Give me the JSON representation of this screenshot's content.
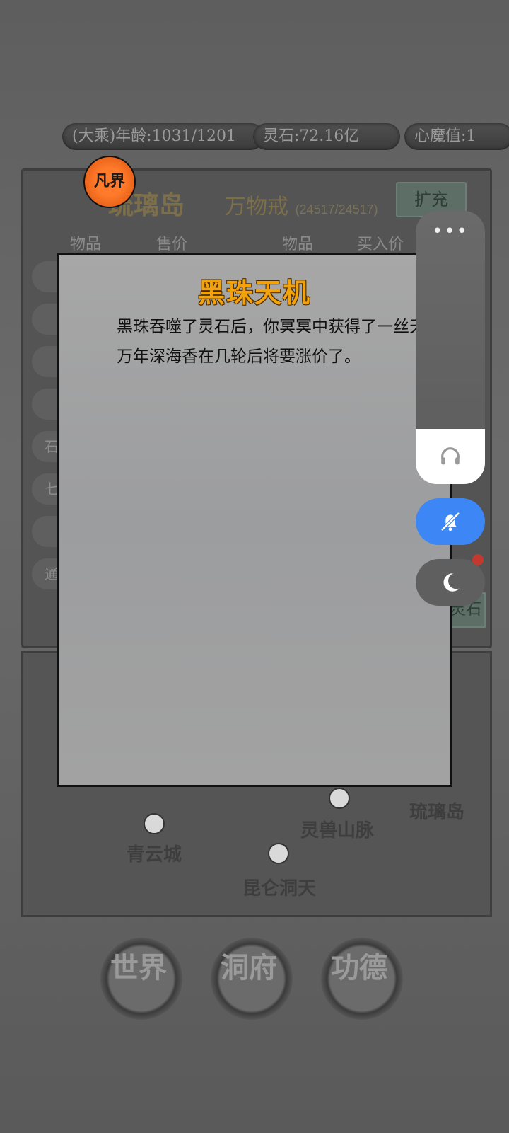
{
  "stats": {
    "realm_age": "(大乘)年龄:1031/1201",
    "spirit_stone": "灵石:72.16亿",
    "demon_value": "心魔值:1"
  },
  "badge": {
    "text": "凡界"
  },
  "shop": {
    "island_name": "琉璃岛",
    "ring_name": "万物戒",
    "ring_count": "(24517/24517)",
    "expand_label": "扩充",
    "col_item_left": "物品",
    "col_sell_price": "售价",
    "col_item_right": "物品",
    "col_buy_price": "买入价",
    "row_stubs": [
      "",
      "",
      "",
      "",
      "石",
      "七",
      "",
      "通"
    ],
    "trade_label": "灵石"
  },
  "map": {
    "locations": [
      "青云城",
      "灵兽山脉",
      "琉璃岛",
      "昆仑洞天"
    ]
  },
  "nav": {
    "world": "世界",
    "cave": "洞府",
    "merit": "功德"
  },
  "dialog": {
    "title": "黑珠天机",
    "paragraph1": "黑珠吞噬了灵石后，你冥冥中获得了一丝天机。",
    "paragraph2": "万年深海香在几轮后将要涨价了。"
  },
  "floating": {
    "more_label": "•••",
    "icons": [
      "headphones-icon",
      "bell-off-icon",
      "moon-icon"
    ],
    "accent": "#3d86f5"
  }
}
